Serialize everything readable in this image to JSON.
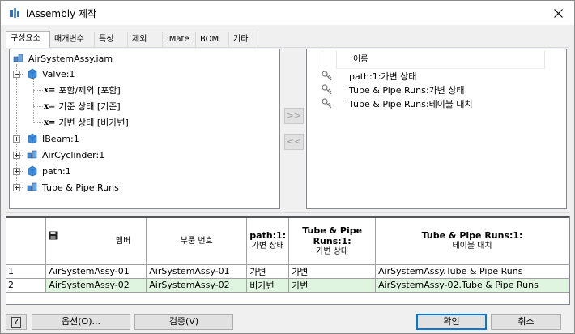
{
  "window": {
    "title": "iAssembly 제작",
    "close_icon": "close-icon"
  },
  "tabs": [
    "구성요소",
    "매개변수",
    "특성",
    "제외",
    "iMate",
    "BOM",
    "기타"
  ],
  "tree": {
    "root": "AirSystemAssy.iam",
    "valve": "Valve:1",
    "valve_children": [
      "포함/제외 [포함]",
      "기준 상태 [기준]",
      "가변 상태 [비가변]"
    ],
    "x_prefix": "x=",
    "ibeam": "IBeam:1",
    "aircylinder": "AirCyclinder:1",
    "path": "path:1",
    "tube": "Tube & Pipe Runs"
  },
  "move": {
    "add": ">>",
    "remove": "<<"
  },
  "props": {
    "header": "이름",
    "items": [
      "path:1:가변 상태",
      "Tube & Pipe Runs:가변 상태",
      "Tube & Pipe Runs:테이블 대치"
    ]
  },
  "grid": {
    "headers": {
      "member": "멤버",
      "part_number": "부품 번호",
      "col3": "path:1:",
      "col3_sub": "가변 상태",
      "col4_a": "Tube & Pipe",
      "col4_b": "Runs:1:",
      "col4_sub": "가변 상태",
      "col5": "Tube & Pipe Runs:1:",
      "col5_sub": "테이블 대치"
    },
    "rows": [
      {
        "n": "1",
        "member": "AirSystemAssy-01",
        "part": "AirSystemAssy-01",
        "path": "가변",
        "tube": "가변",
        "sub": "AirSystemAssy.Tube & Pipe Runs"
      },
      {
        "n": "2",
        "member": "AirSystemAssy-02",
        "part": "AirSystemAssy-02",
        "path": "비가변",
        "tube": "가변",
        "sub": "AirSystemAssy-02.Tube & Pipe Runs"
      }
    ]
  },
  "buttons": {
    "help": "?",
    "options": "옵션(O)...",
    "verify": "검증(V)",
    "ok": "확인",
    "cancel": "취소"
  }
}
